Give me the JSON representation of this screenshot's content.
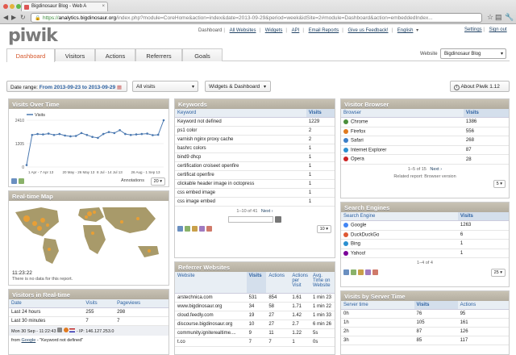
{
  "browser": {
    "tab_title": "Bigdinosaur Blog - Web A",
    "url_scheme": "https://",
    "url_host": "analytics.bigdinosaur.org",
    "url_rest": "/index.php?module=CoreHome&action=index&date=2013-09-29&period=week&idSite=2#module=Dashboard&action=embeddedIndex..."
  },
  "header": {
    "logo": "piwik",
    "nav": [
      "Dashboard",
      "All Websites",
      "Widgets",
      "API",
      "Email Reports",
      "Give us Feedback!",
      "English"
    ],
    "right_links": [
      "Settings",
      "Sign out"
    ]
  },
  "tabs": [
    "Dashboard",
    "Visitors",
    "Actions",
    "Referrers",
    "Goals"
  ],
  "website": {
    "label": "Website",
    "value": "Bigdinosaur Blog"
  },
  "controls": {
    "date_prefix": "Date range:",
    "date_value": "From 2013-09-23 to 2013-09-29",
    "segment": "All visits",
    "widgets": "Widgets & Dashboard",
    "about": "About Piwik 1.12"
  },
  "visits_over_time": {
    "title": "Visits Over Time",
    "legend": "Visits",
    "y_ticks": [
      "2410",
      "1205",
      "0"
    ],
    "x_ticks": [
      "1 Apr - 7 Apr 13",
      "20 May - 26 May 13",
      "8 Jul - 14 Jul 13",
      "26 Aug - 1 Sep 13"
    ],
    "annotations": "Annotations",
    "limit": "20"
  },
  "chart_data": {
    "type": "line",
    "series": [
      {
        "name": "Visits",
        "values": [
          100,
          1650,
          1700,
          1680,
          1720,
          1650,
          1700,
          1620,
          1580,
          1600,
          1750,
          1650,
          1550,
          1500,
          1700,
          1800,
          1750,
          1900,
          1700,
          1650,
          1680,
          1700,
          1720,
          1640,
          1660,
          2410
        ]
      }
    ],
    "ylim": [
      0,
      2410
    ],
    "grid": true
  },
  "realtime_map": {
    "title": "Real-time Map",
    "time": "11:23:22",
    "note": "There is no data for this report."
  },
  "visitors_realtime": {
    "title": "Visitors in Real-time",
    "columns": [
      "Date",
      "Visits",
      "Pageviews"
    ],
    "rows": [
      [
        "Last 24 hours",
        "255",
        "298"
      ],
      [
        "Last 30 minutes",
        "7",
        "7"
      ]
    ],
    "last_visit": "Mon 30 Sep - 11:22:43",
    "ip": "- IP: 146.127.253.0",
    "from_prefix": "from",
    "from_link": "Google",
    "from_keyword": "- \"Keyword not defined\""
  },
  "keywords": {
    "title": "Keywords",
    "columns": [
      "Keyword",
      "Visits"
    ],
    "rows": [
      [
        "Keyword not defined",
        "1229"
      ],
      [
        "ps1 color",
        "2"
      ],
      [
        "varnish nginx proxy cache",
        "2"
      ],
      [
        "bashrc colors",
        "1"
      ],
      [
        "bind9 dhcp",
        "1"
      ],
      [
        "certification croiseet openfire",
        "1"
      ],
      [
        "certificat openfire",
        "1"
      ],
      [
        "clickable header image in octopress",
        "1"
      ],
      [
        "css embed image",
        "1"
      ],
      [
        "css image embed",
        "1"
      ]
    ],
    "pager": "1–10 of 41",
    "next": "Next ›",
    "limit": "10"
  },
  "referrer_websites": {
    "title": "Referrer Websites",
    "columns": [
      "Website",
      "Visits",
      "Actions",
      "Actions per Visit",
      "Avg. Time on Website"
    ],
    "rows": [
      [
        "arstechnica.com",
        "531",
        "854",
        "1.61",
        "1 min 23"
      ],
      [
        "www.bigdinosaur.org",
        "34",
        "58",
        "1.71",
        "1 min 22"
      ],
      [
        "cloud.feedly.com",
        "19",
        "27",
        "1.42",
        "1 min 33"
      ],
      [
        "discourse.bigdinosaur.org",
        "10",
        "27",
        "2.7",
        "6 min 26"
      ],
      [
        "community.igniterealtime....",
        "9",
        "11",
        "1.22",
        "5s"
      ],
      [
        "t.co",
        "7",
        "7",
        "1",
        "0s"
      ]
    ]
  },
  "visitor_browser": {
    "title": "Visitor Browser",
    "columns": [
      "Browser",
      "Visits"
    ],
    "rows": [
      {
        "name": "Chrome",
        "visits": "1386",
        "color": "#4a8f3c"
      },
      {
        "name": "Firefox",
        "visits": "556",
        "color": "#e07a1f"
      },
      {
        "name": "Safari",
        "visits": "268",
        "color": "#3c7fc8"
      },
      {
        "name": "Internet Explorer",
        "visits": "87",
        "color": "#2a8fd0"
      },
      {
        "name": "Opera",
        "visits": "28",
        "color": "#cc2222"
      }
    ],
    "pager": "1–5 of 15",
    "next": "Next ›",
    "related": "Related report: Browser version",
    "limit": "5"
  },
  "search_engines": {
    "title": "Search Engines",
    "columns": [
      "Search Engine",
      "Visits"
    ],
    "rows": [
      {
        "name": "Google",
        "visits": "1263",
        "color": "#4285f4"
      },
      {
        "name": "DuckDuckGo",
        "visits": "6",
        "color": "#de5833"
      },
      {
        "name": "Bing",
        "visits": "1",
        "color": "#2a8fd0"
      },
      {
        "name": "Yahoo!",
        "visits": "1",
        "color": "#7b0099"
      }
    ],
    "pager": "1–4 of 4",
    "limit": "25"
  },
  "server_time": {
    "title": "Visits by Server Time",
    "columns": [
      "Server time",
      "Visits",
      "Actions"
    ],
    "rows": [
      [
        "0h",
        "76",
        "95"
      ],
      [
        "1h",
        "105",
        "161"
      ],
      [
        "2h",
        "87",
        "126"
      ],
      [
        "3h",
        "85",
        "117"
      ]
    ]
  }
}
